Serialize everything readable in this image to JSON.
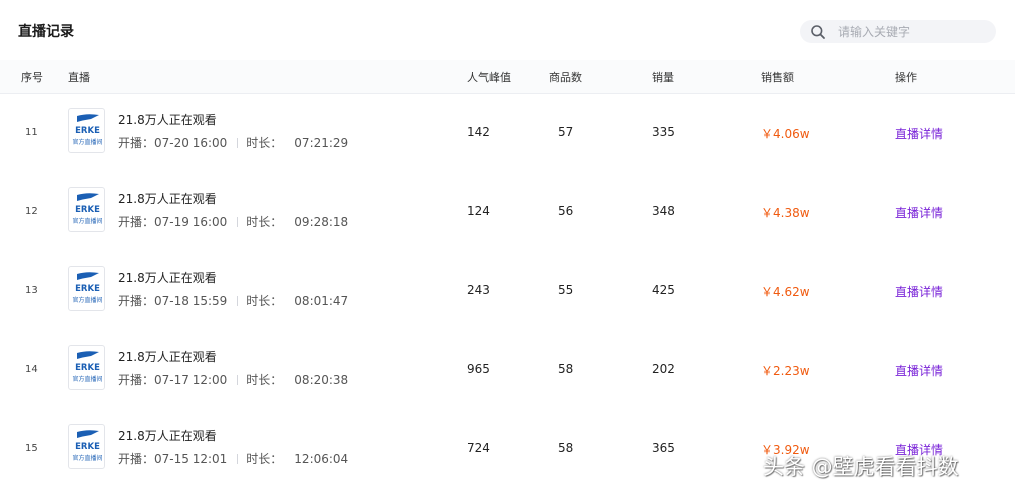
{
  "page": {
    "title": "直播记录"
  },
  "search": {
    "placeholder": "请输入关键字",
    "icon": "search-icon"
  },
  "table": {
    "columns": {
      "index": "序号",
      "live": "直播",
      "peak": "人气峰值",
      "products": "商品数",
      "sales": "销量",
      "revenue": "销售额",
      "operation": "操作"
    },
    "labels": {
      "start": "开播：",
      "duration": "时长："
    },
    "rows": [
      {
        "index": "11",
        "viewers": "21.8万人正在观看",
        "start_time": "07-20 16:00",
        "duration": "07:21:29",
        "peak": "142",
        "products": "57",
        "sales": "335",
        "revenue": "￥4.06w",
        "action": "直播详情"
      },
      {
        "index": "12",
        "viewers": "21.8万人正在观看",
        "start_time": "07-19 16:00",
        "duration": "09:28:18",
        "peak": "124",
        "products": "56",
        "sales": "348",
        "revenue": "￥4.38w",
        "action": "直播详情"
      },
      {
        "index": "13",
        "viewers": "21.8万人正在观看",
        "start_time": "07-18 15:59",
        "duration": "08:01:47",
        "peak": "243",
        "products": "55",
        "sales": "425",
        "revenue": "￥4.62w",
        "action": "直播详情"
      },
      {
        "index": "14",
        "viewers": "21.8万人正在观看",
        "start_time": "07-17 12:00",
        "duration": "08:20:38",
        "peak": "965",
        "products": "58",
        "sales": "202",
        "revenue": "￥2.23w",
        "action": "直播详情"
      },
      {
        "index": "15",
        "viewers": "21.8万人正在观看",
        "start_time": "07-15 12:01",
        "duration": "12:06:04",
        "peak": "724",
        "products": "58",
        "sales": "365",
        "revenue": "￥3.92w",
        "action": "直播详情"
      }
    ]
  },
  "thumbnail": {
    "brand": "ERKE",
    "caption": "官方直播间"
  },
  "watermark": {
    "text": "头条 @壁虎看看抖数"
  },
  "colors": {
    "accent_link": "#7a24d8",
    "revenue": "#f05a0f",
    "brand_blue": "#1b5fb4"
  }
}
